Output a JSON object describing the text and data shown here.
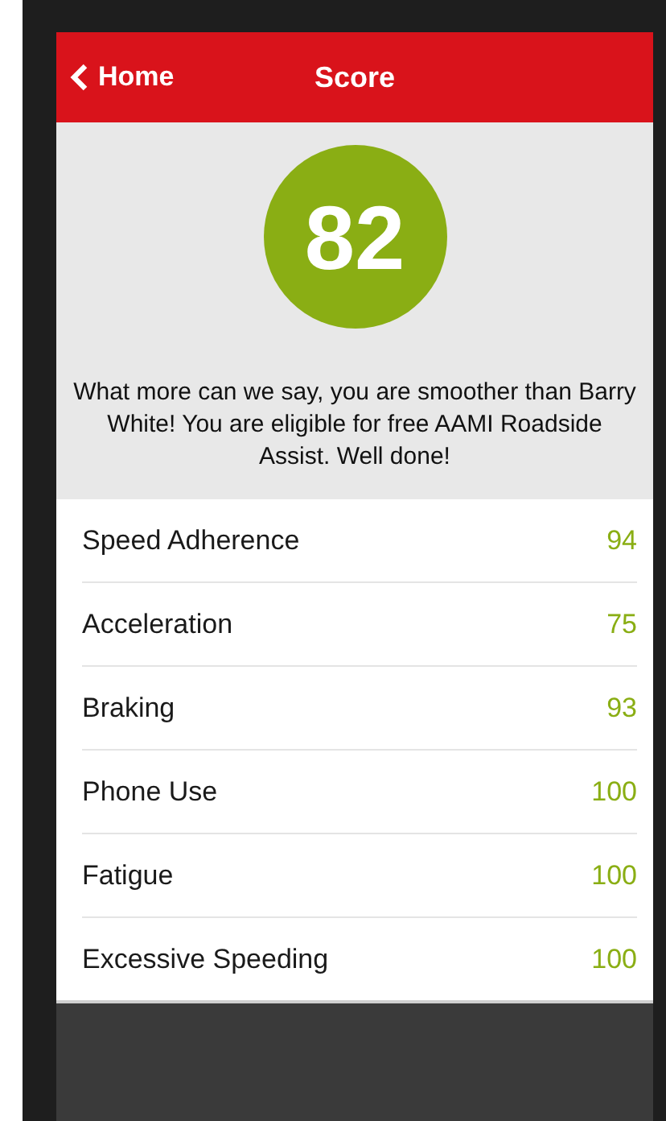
{
  "header": {
    "back": "Home",
    "title": "Score"
  },
  "score": {
    "value": "82",
    "message": "What more can we say, you are smoother than Barry White! You are eligible for free AAMI Roadside Assist. Well done!"
  },
  "metrics": [
    {
      "label": "Speed Adherence",
      "value": "94"
    },
    {
      "label": "Acceleration",
      "value": "75"
    },
    {
      "label": "Braking",
      "value": "93"
    },
    {
      "label": "Phone Use",
      "value": "100"
    },
    {
      "label": "Fatigue",
      "value": "100"
    },
    {
      "label": "Excessive Speeding",
      "value": "100"
    }
  ]
}
